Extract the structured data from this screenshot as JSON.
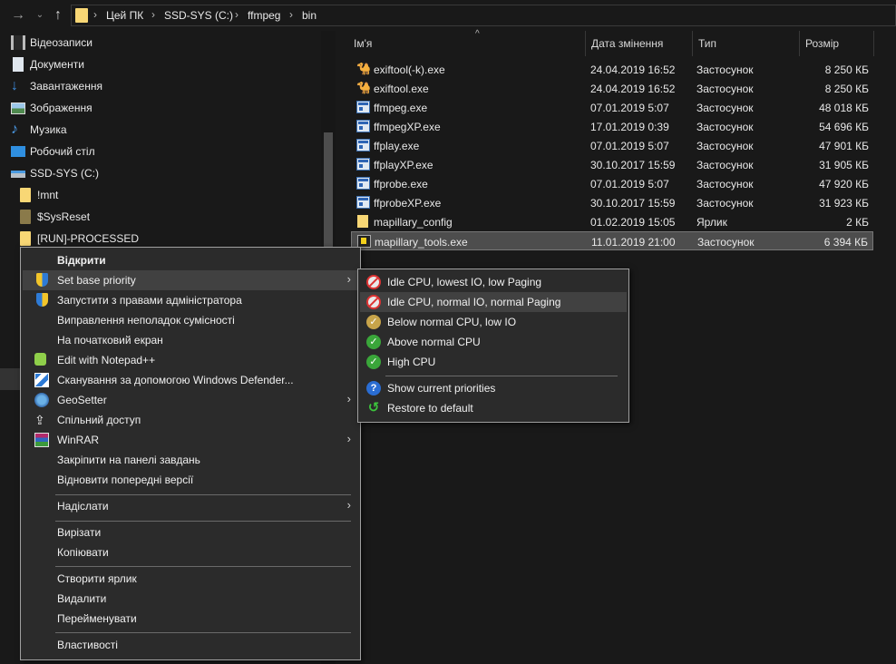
{
  "address": {
    "crumbs": [
      "Цей ПК",
      "SSD-SYS (C:)",
      "ffmpeg",
      "bin"
    ],
    "separator": "›"
  },
  "nav": {
    "items": [
      {
        "label": "Відеозаписи",
        "icon": "videos-icon"
      },
      {
        "label": "Документи",
        "icon": "documents-icon"
      },
      {
        "label": "Завантаження",
        "icon": "downloads-icon"
      },
      {
        "label": "Зображення",
        "icon": "pictures-icon"
      },
      {
        "label": "Музика",
        "icon": "music-icon"
      },
      {
        "label": "Робочий стіл",
        "icon": "desktop-icon"
      },
      {
        "label": "SSD-SYS (C:)",
        "icon": "drive-icon"
      },
      {
        "label": "!mnt",
        "icon": "folder-icon"
      },
      {
        "label": "$SysReset",
        "icon": "folder-icon"
      },
      {
        "label": "[RUN]-PROCESSED",
        "icon": "folder-icon"
      }
    ]
  },
  "filelist": {
    "columns": {
      "name": "Ім'я",
      "date": "Дата змінення",
      "type": "Тип",
      "size": "Розмір"
    },
    "sort_caret": "^",
    "rows": [
      {
        "name": "exiftool(-k).exe",
        "date": "24.04.2019 16:52",
        "type": "Застосунок",
        "size": "8 250 КБ",
        "icon": "camel-icon"
      },
      {
        "name": "exiftool.exe",
        "date": "24.04.2019 16:52",
        "type": "Застосунок",
        "size": "8 250 КБ",
        "icon": "camel-icon"
      },
      {
        "name": "ffmpeg.exe",
        "date": "07.01.2019 5:07",
        "type": "Застосунок",
        "size": "48 018 КБ",
        "icon": "exe-icon"
      },
      {
        "name": "ffmpegXP.exe",
        "date": "17.01.2019 0:39",
        "type": "Застосунок",
        "size": "54 696 КБ",
        "icon": "exe-icon"
      },
      {
        "name": "ffplay.exe",
        "date": "07.01.2019 5:07",
        "type": "Застосунок",
        "size": "47 901 КБ",
        "icon": "exe-icon"
      },
      {
        "name": "ffplayXP.exe",
        "date": "30.10.2017 15:59",
        "type": "Застосунок",
        "size": "31 905 КБ",
        "icon": "exe-icon"
      },
      {
        "name": "ffprobe.exe",
        "date": "07.01.2019 5:07",
        "type": "Застосунок",
        "size": "47 920 КБ",
        "icon": "exe-icon"
      },
      {
        "name": "ffprobeXP.exe",
        "date": "30.10.2017 15:59",
        "type": "Застосунок",
        "size": "31 923 КБ",
        "icon": "exe-icon"
      },
      {
        "name": "mapillary_config",
        "date": "01.02.2019 15:05",
        "type": "Ярлик",
        "size": "2 КБ",
        "icon": "shortcut-icon"
      },
      {
        "name": "mapillary_tools.exe",
        "date": "11.01.2019 21:00",
        "type": "Застосунок",
        "size": "6 394 КБ",
        "icon": "app-icon",
        "selected": true
      }
    ]
  },
  "context_menu": {
    "items": [
      {
        "label": "Відкрити",
        "bold": true
      },
      {
        "label": "Set base priority",
        "icon": "shield-icon",
        "submenu": true,
        "active": true
      },
      {
        "label": "Запустити з правами адміністратора",
        "icon": "uac-shield-icon"
      },
      {
        "label": "Виправлення неполадок сумісності"
      },
      {
        "label": "На початковий екран"
      },
      {
        "label": "Edit with Notepad++",
        "icon": "notepadpp-icon"
      },
      {
        "label": "Сканування за допомогою Windows Defender...",
        "icon": "defender-icon"
      },
      {
        "label": "GeoSetter",
        "icon": "globe-icon",
        "submenu": true
      },
      {
        "label": "Спільний доступ",
        "icon": "share-icon"
      },
      {
        "label": "WinRAR",
        "icon": "winrar-icon",
        "submenu": true
      },
      {
        "label": "Закріпити на панелі завдань"
      },
      {
        "label": "Відновити попередні версії"
      },
      {
        "label": "Надіслати",
        "submenu": true
      },
      {
        "label": "Вирізати"
      },
      {
        "label": "Копіювати"
      },
      {
        "label": "Створити ярлик"
      },
      {
        "label": "Видалити"
      },
      {
        "label": "Перейменувати"
      },
      {
        "label": "Властивості"
      }
    ],
    "arrow": "›"
  },
  "submenu": {
    "items": [
      {
        "label": "Idle CPU, lowest IO, low Paging",
        "icon": "idle-icon"
      },
      {
        "label": "Idle CPU, normal IO, normal Paging",
        "icon": "idle-icon",
        "active": true
      },
      {
        "label": "Below normal CPU, low IO",
        "icon": "below-normal-icon"
      },
      {
        "label": "Above normal CPU",
        "icon": "above-normal-icon"
      },
      {
        "label": "High CPU",
        "icon": "high-icon"
      },
      {
        "label": "Show current priorities",
        "icon": "help-icon"
      },
      {
        "label": "Restore to default",
        "icon": "restore-icon"
      }
    ],
    "glyphs": {
      "below": "✓",
      "above": "✓",
      "high": "✓",
      "help": "?",
      "restore": "↺"
    }
  }
}
